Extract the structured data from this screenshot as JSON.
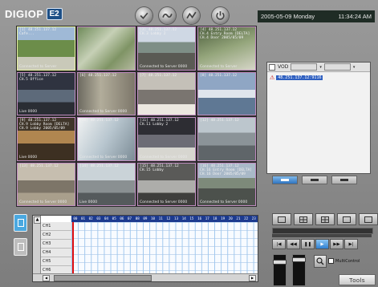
{
  "app": {
    "brand": "DIGIOP",
    "model": "E2"
  },
  "header": {
    "date": "2005-05-09 Monday",
    "time": "11:34:24 AM"
  },
  "cameras": [
    {
      "hdr": "[1] 48.251.137.12\nCafe...",
      "ftr": "Connected to Server",
      "scene": "lawn"
    },
    {
      "hdr": "",
      "ftr": "",
      "scene": "trees"
    },
    {
      "hdr": "[3] 48.251.137.12\nCH.3 Lobby 2",
      "ftr": "Connected to Server 0000",
      "scene": "street"
    },
    {
      "hdr": "[4] 48.251.137.12\nCH.4 Entry Room [DELTA]\nCH.4 Door 2005/05/09",
      "ftr": "Connected to Server",
      "scene": "trees2"
    },
    {
      "hdr": "[5] 48.251.137.12\nCH.5 Office",
      "ftr": "Live  0000",
      "scene": "office"
    },
    {
      "hdr": "[6] 48.251.137.12",
      "ftr": "Connected to Server 0000",
      "scene": "hall"
    },
    {
      "hdr": "[7] 48.251.137.12",
      "ftr": "",
      "scene": "room"
    },
    {
      "hdr": "[8] 48.251.137.12",
      "ftr": "",
      "scene": "blue"
    },
    {
      "hdr": "[9] 48.251.137.12\nCH.9 Lobby Room [DELTA]\nCH.9 Lobby 2005/05/09",
      "ftr": "Live  0000",
      "scene": "lobby"
    },
    {
      "hdr": "[10] 48.251.137.12",
      "ftr": "Connected to Server 0000",
      "scene": "bright"
    },
    {
      "hdr": "[11] 48.251.137.12\nCH.11 Lobby 2",
      "ftr": "Connected to Server 0000",
      "scene": "desk"
    },
    {
      "hdr": "[12] 48.251.137.12",
      "ftr": "",
      "scene": "cars"
    },
    {
      "hdr": "[13] 48.251.137.12",
      "ftr": "Connected to Server 0000",
      "scene": "office2"
    },
    {
      "hdr": "[14] 48.251.137.12",
      "ftr": "Live  0000",
      "scene": "parking"
    },
    {
      "hdr": "[15] 48.251.137.12\nCH.15 Lobby",
      "ftr": "Connected to Server 0000",
      "scene": "warehouse"
    },
    {
      "hdr": "[16] 48.251.137.12\nCH.16 Entry Room [DELTA]\nCH.16 Door 2005/05/09",
      "ftr": "Connected to Server 0000",
      "scene": "street2"
    }
  ],
  "vod": {
    "label": "VOD",
    "select1": "",
    "select2": "",
    "item": "48.251.137.12:9116"
  },
  "timeline": {
    "hours": [
      "00",
      "01",
      "02",
      "03",
      "04",
      "05",
      "06",
      "07",
      "08",
      "09",
      "10",
      "11",
      "12",
      "13",
      "14",
      "15",
      "16",
      "17",
      "18",
      "19",
      "20",
      "21",
      "22",
      "23"
    ],
    "channels": [
      "CH1",
      "CH2",
      "CH3",
      "CH4",
      "CH5",
      "CH6"
    ]
  },
  "controls": {
    "play_buttons": [
      "|◀",
      "◀◀",
      "❚❚",
      "▶",
      "▶▶",
      "▶|"
    ],
    "multicontrol": "MultiControl",
    "tools": "Tools"
  }
}
